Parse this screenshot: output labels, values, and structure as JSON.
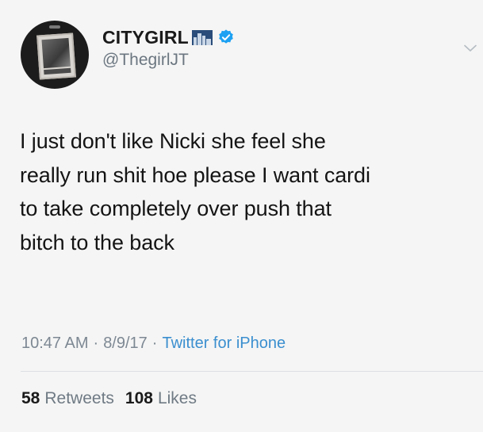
{
  "user": {
    "display_name": "CITYGIRL",
    "handle": "@ThegirlJT",
    "flag_icon": "city-flag-icon",
    "verified_icon": "verified-badge-icon",
    "accent_color": "#1da1f2"
  },
  "tweet": {
    "text": "I just don't like Nicki she feel she\nreally run shit hoe please I want cardi\nto take completely over push that\nbitch to the back",
    "time": "10:47 AM",
    "date": "8/9/17",
    "source": "Twitter for iPhone",
    "separator": "·"
  },
  "stats": {
    "retweets_count": "58",
    "retweets_label": "Retweets",
    "likes_count": "108",
    "likes_label": "Likes"
  }
}
